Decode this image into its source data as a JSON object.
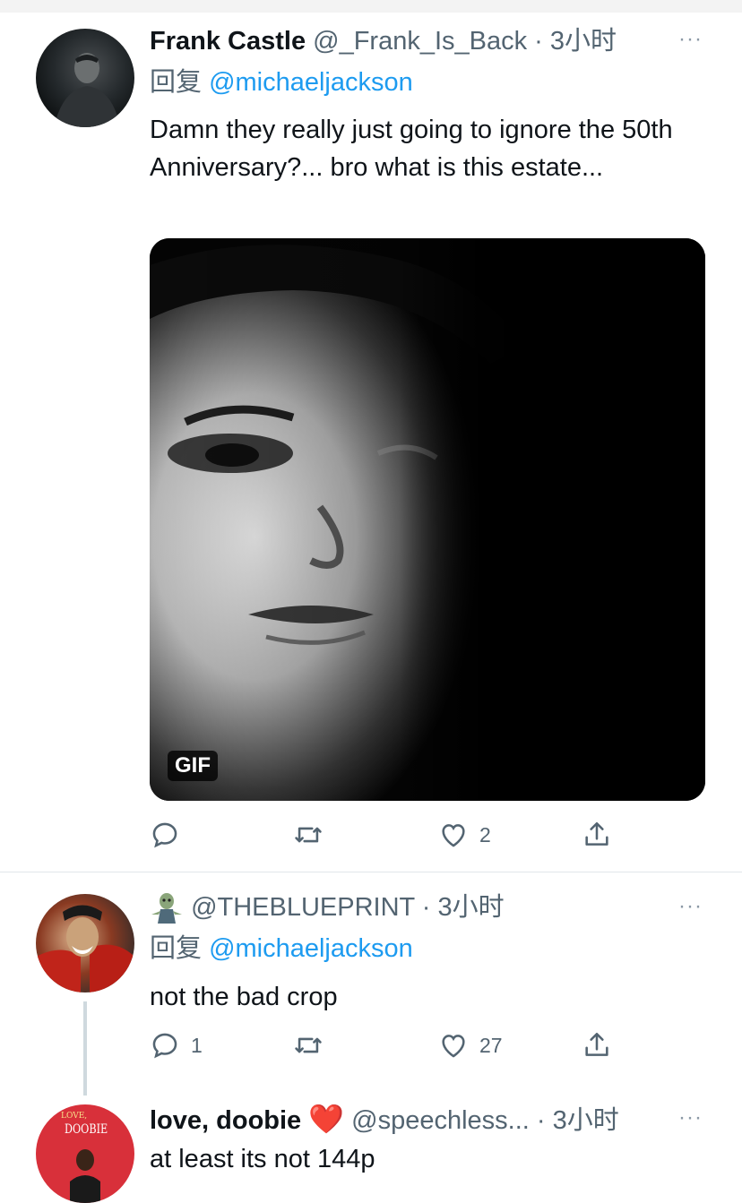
{
  "tweets": [
    {
      "name": "Frank Castle",
      "handle": "@_Frank_Is_Back",
      "time": " · 3小时",
      "reply_prefix": "回复 ",
      "reply_to": "@michaeljackson",
      "text": "Damn they really just going to ignore the 50th Anniversary?... bro what is this estate...",
      "media_badge": "GIF",
      "actions": {
        "reply_count": "",
        "retweet_count": "",
        "like_count": "2"
      }
    },
    {
      "name": "",
      "handle": "@THEBLUEPRINT",
      "time": " · 3小时",
      "reply_prefix": "回复 ",
      "reply_to": "@michaeljackson",
      "text": "not the bad crop",
      "actions": {
        "reply_count": "1",
        "retweet_count": "",
        "like_count": "27"
      }
    },
    {
      "name": "love, doobie",
      "name_emoji": "❤️",
      "handle": "@speechless...",
      "time": " · 3小时",
      "text": "at least its not 144p",
      "avatar_text_top": "LOVE,",
      "avatar_text": "DOOBIE"
    }
  ],
  "more_label": "···",
  "colors": {
    "link": "#1d9bf0",
    "muted": "#536471",
    "text": "#0f1419"
  },
  "icons": [
    "reply-icon",
    "retweet-icon",
    "like-icon",
    "share-icon",
    "more-icon",
    "zombie-icon",
    "heart-emoji-icon"
  ]
}
